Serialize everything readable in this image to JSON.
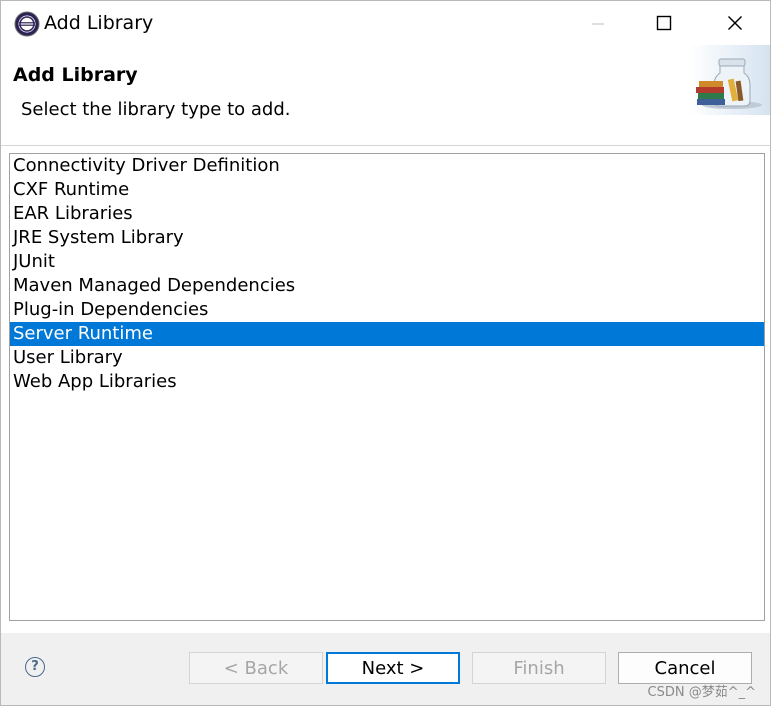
{
  "window": {
    "title": "Add Library"
  },
  "header": {
    "title": "Add Library",
    "subtitle": "Select the library type to add."
  },
  "library_types": [
    {
      "label": "Connectivity Driver Definition",
      "selected": false
    },
    {
      "label": "CXF Runtime",
      "selected": false
    },
    {
      "label": "EAR Libraries",
      "selected": false
    },
    {
      "label": "JRE System Library",
      "selected": false
    },
    {
      "label": "JUnit",
      "selected": false
    },
    {
      "label": "Maven Managed Dependencies",
      "selected": false
    },
    {
      "label": "Plug-in Dependencies",
      "selected": false
    },
    {
      "label": "Server Runtime",
      "selected": true
    },
    {
      "label": "User Library",
      "selected": false
    },
    {
      "label": "Web App Libraries",
      "selected": false
    }
  ],
  "buttons": {
    "back": "< Back",
    "next": "Next >",
    "finish": "Finish",
    "cancel": "Cancel"
  },
  "help": {
    "glyph": "?"
  },
  "watermark": "CSDN @梦茹^_^",
  "colors": {
    "selection": "#0078d7",
    "footer_bg": "#f0f0f0"
  }
}
